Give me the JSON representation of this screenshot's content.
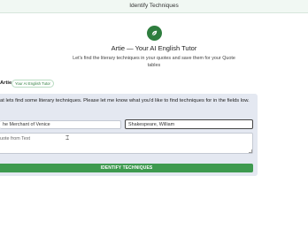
{
  "header": {
    "title": "Identify Techniques"
  },
  "intro": {
    "logo_icon": "leaf-icon",
    "title": "Artie — Your AI English Tutor",
    "subtitle": "Let's find the literary techniques in your quotes and save them for your Quote tables"
  },
  "chat": {
    "author": "Artie",
    "badge": "Your AI English Tutor",
    "message": "at lets find some literary techniques. Please let me know what you'd like to find techniques for in the fields low."
  },
  "form": {
    "book_value": "he Merchant of Venice",
    "author_value": "Shakespeare, William",
    "quote_placeholder": "uote from Text",
    "submit_label": "IDENTIFY TECHNIQUES"
  },
  "colors": {
    "accent": "#3e9a4f",
    "logo": "#2e7d3e",
    "card": "#e4e8f1",
    "topbar": "#f1f8f3"
  }
}
